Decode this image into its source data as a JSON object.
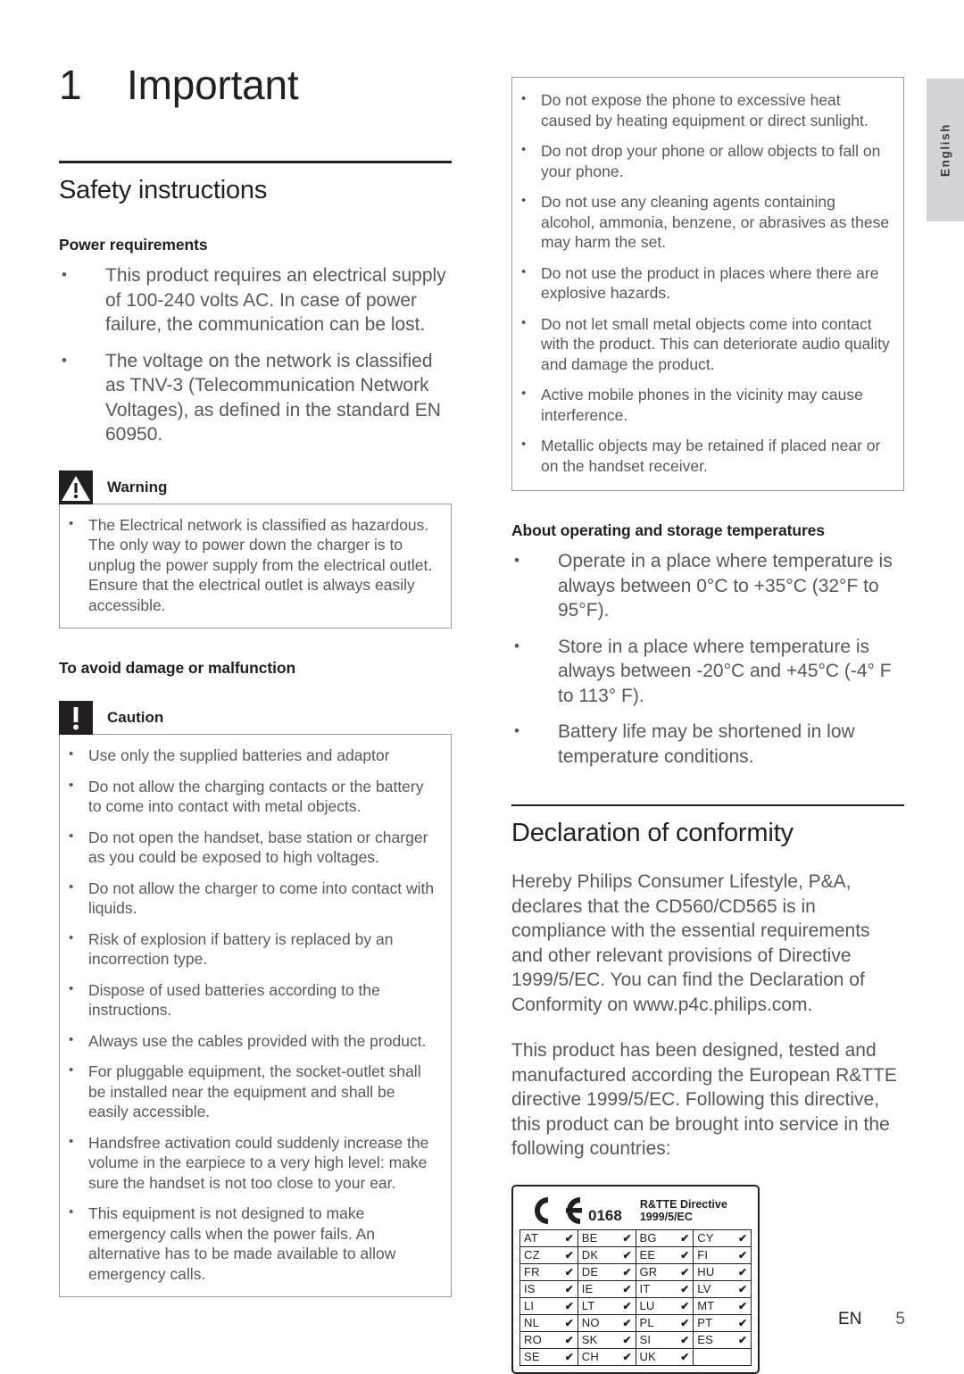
{
  "language_tab": {
    "label": "English"
  },
  "chapter": {
    "number": "1",
    "title": "Important"
  },
  "sections": {
    "safety": {
      "title": "Safety instructions",
      "power_requirements": {
        "heading": "Power requirements",
        "bullets": [
          "This product requires an electrical supply of 100-240 volts AC. In case of power failure, the communication can be lost.",
          "The voltage on the network is classified as TNV-3 (Telecommunication Network Voltages), as defined in the standard EN 60950."
        ]
      },
      "warning": {
        "label": "Warning",
        "icon": "warning-triangle-icon",
        "bullets": [
          "The Electrical network is classified as hazardous. The only way to power down the charger is to unplug the power supply from the electrical outlet. Ensure that the electrical outlet is always easily accessible."
        ]
      },
      "avoid_damage": {
        "heading": "To avoid damage or malfunction"
      },
      "caution": {
        "label": "Caution",
        "icon": "caution-exclamation-icon",
        "bullets": [
          "Use only the supplied batteries and adaptor",
          "Do not allow the charging contacts or the battery to come into contact with metal objects.",
          "Do not open the handset, base station or charger as you could be exposed to high voltages.",
          "Do not allow the charger to come into contact with liquids.",
          "Risk of explosion if battery is replaced by an incorrection type.",
          "Dispose of used batteries according to the instructions.",
          "Always use the cables provided with the product.",
          "For pluggable equipment, the socket-outlet shall be installed near the equipment and shall be easily accessible.",
          "Handsfree activation could suddenly increase the volume in the earpiece to a very high level: make sure the handset is not too close to your ear.",
          "This equipment is not designed to make emergency calls when the power fails. An alternative has to be made available to allow emergency calls."
        ]
      },
      "caution_continued": {
        "bullets": [
          "Do not expose the phone to excessive heat caused by heating equipment or direct sunlight.",
          "Do not drop your phone or allow objects to fall on your phone.",
          "Do not use any cleaning agents containing alcohol, ammonia, benzene, or abrasives as these may harm the set.",
          "Do not use the product in places where there are explosive hazards.",
          "Do not let small metal objects come into contact with the product. This can deteriorate audio quality and damage the product.",
          "Active mobile phones in the vicinity may cause interference.",
          "Metallic objects may be retained if placed near or on the handset receiver."
        ]
      },
      "temperatures": {
        "heading": "About operating and storage temperatures",
        "bullets": [
          "Operate in a place where temperature is always between 0°C to +35°C (32°F to 95°F).",
          "Store in a place where temperature is always between -20°C and +45°C (-4° F to 113° F).",
          "Battery life may be shortened in low temperature conditions."
        ]
      }
    },
    "conformity": {
      "title": "Declaration of conformity",
      "paragraphs": [
        "Hereby Philips Consumer Lifestyle, P&A, declares that the CD560/CD565 is in compliance with the essential requirements and other relevant provisions of Directive 1999/5/EC. You can find the Declaration of Conformity on www.p4c.philips.com.",
        "This product has been designed, tested and manufactured according the European R&TTE directive 1999/5/EC. Following this directive, this product can be brought into service in the following countries:"
      ],
      "ce_block": {
        "ce_mark_icon": "ce-mark-icon",
        "notified_body_number": "0168",
        "directive_line1": "R&TTE Directive",
        "directive_line2": "1999/5/EC",
        "tick": "✔",
        "country_rows": [
          [
            "AT",
            "BE",
            "BG",
            "CY"
          ],
          [
            "CZ",
            "DK",
            "EE",
            "FI"
          ],
          [
            "FR",
            "DE",
            "GR",
            "HU"
          ],
          [
            "IS",
            "IE",
            "IT",
            "LV"
          ],
          [
            "LI",
            "LT",
            "LU",
            "MT"
          ],
          [
            "NL",
            "NO",
            "PL",
            "PT"
          ],
          [
            "RO",
            "SK",
            "SI",
            "ES"
          ],
          [
            "SE",
            "CH",
            "UK",
            ""
          ]
        ]
      }
    }
  },
  "footer": {
    "language_code": "EN",
    "page_number": "5"
  }
}
